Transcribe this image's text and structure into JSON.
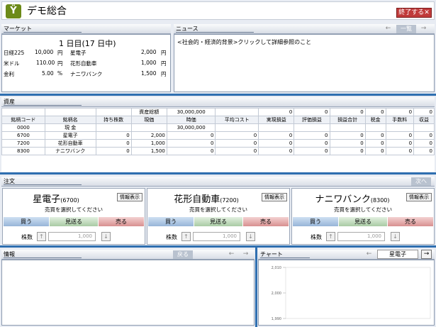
{
  "app": {
    "logo_text": "Ÿ",
    "title": "デモ総合",
    "exit_label": "終了する",
    "exit_icon": "✕"
  },
  "market": {
    "header": "マーケット",
    "day_label": "1 日目(17 日中)",
    "indicators": [
      {
        "label": "日経225",
        "value": "10,000",
        "unit": "円"
      },
      {
        "label": "米ドル",
        "value": "110.00",
        "unit": "円"
      },
      {
        "label": "金利",
        "value": "5.00",
        "unit": "%"
      }
    ],
    "stocks": [
      {
        "name": "星電子",
        "price": "2,000",
        "unit": "円"
      },
      {
        "name": "花形自動車",
        "price": "1,000",
        "unit": "円"
      },
      {
        "name": "ナニワバンク",
        "price": "1,500",
        "unit": "円"
      }
    ]
  },
  "news": {
    "header": "ニュース",
    "list_label": "一覧",
    "text": "<社会的・経済的背景>クリックして詳細参照のこと"
  },
  "assets": {
    "header": "資産",
    "total_label": "資産総額",
    "total_value": "30,000,000",
    "total_row_values": [
      "0",
      "0",
      "0",
      "0",
      "0",
      "0",
      "0"
    ],
    "columns": [
      "銘柄コード",
      "銘柄名",
      "持ち株数",
      "現価",
      "時価",
      "平均コスト",
      "実現損益",
      "評価損益",
      "損益合計",
      "税金",
      "手数料",
      "収益"
    ],
    "rows": [
      [
        "0000",
        "現 金",
        "",
        "",
        "30,000,000",
        "",
        "",
        "",
        "",
        "",
        "",
        ""
      ],
      [
        "6700",
        "星電子",
        "0",
        "2,000",
        "0",
        "0",
        "0",
        "0",
        "0",
        "0",
        "0",
        "0"
      ],
      [
        "7200",
        "花形自動車",
        "0",
        "1,000",
        "0",
        "0",
        "0",
        "0",
        "0",
        "0",
        "0",
        "0"
      ],
      [
        "8300",
        "ナニワバンク",
        "0",
        "1,500",
        "0",
        "0",
        "0",
        "0",
        "0",
        "0",
        "0",
        "0"
      ]
    ]
  },
  "orders": {
    "header": "注文",
    "next_label": "次へ",
    "hint": "売買を選択してください",
    "info_label": "情報表示",
    "buy_label": "買う",
    "hold_label": "見送る",
    "sell_label": "売る",
    "qty_label": "株数",
    "items": [
      {
        "name": "星電子",
        "code": "(6700)",
        "qty": "1,000"
      },
      {
        "name": "花形自動車",
        "code": "(7200)",
        "qty": "1,000"
      },
      {
        "name": "ナニワバンク",
        "code": "(8300)",
        "qty": "1,000"
      }
    ]
  },
  "info": {
    "header": "情報",
    "back_label": "戻る"
  },
  "chart": {
    "header": "チャート",
    "selected": "星電子"
  },
  "chart_data": {
    "type": "line",
    "title": "",
    "xlabel": "",
    "ylabel": "",
    "y_ticks": [
      "2,010",
      "2,000",
      "1,990"
    ],
    "ylim": [
      1990,
      2010
    ],
    "series": []
  }
}
